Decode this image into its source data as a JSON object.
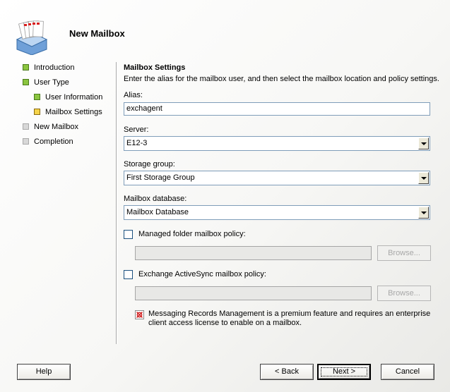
{
  "window": {
    "title": "New Mailbox",
    "header_icon": "mailbox-stack-icon"
  },
  "nav": {
    "items": [
      {
        "label": "Introduction",
        "state": "completed"
      },
      {
        "label": "User Type",
        "state": "completed"
      },
      {
        "label": "User Information",
        "state": "completed"
      },
      {
        "label": "Mailbox Settings",
        "state": "current"
      },
      {
        "label": "New Mailbox",
        "state": "pending"
      },
      {
        "label": "Completion",
        "state": "pending"
      }
    ]
  },
  "main": {
    "section_title": "Mailbox Settings",
    "section_description": "Enter the alias for the mailbox user, and then select the mailbox location and policy settings.",
    "alias": {
      "label": "Alias:",
      "value": "exchagent"
    },
    "server": {
      "label": "Server:",
      "selected": "E12-3"
    },
    "storage_group": {
      "label": "Storage group:",
      "selected": "First Storage Group"
    },
    "mailbox_database": {
      "label": "Mailbox database:",
      "selected": "Mailbox Database"
    },
    "managed_folder_policy": {
      "label": "Managed folder mailbox policy:",
      "checked": false,
      "value": "",
      "browse_label": "Browse..."
    },
    "activesync_policy": {
      "label": "Exchange ActiveSync mailbox policy:",
      "checked": false,
      "value": "",
      "browse_label": "Browse..."
    },
    "note": {
      "icon": "premium-feature-icon",
      "text": "Messaging Records Management is a premium feature and requires an enterprise client access license to enable on a mailbox."
    }
  },
  "footer": {
    "help_label": "Help",
    "back_label": "< Back",
    "next_label": "Next >",
    "cancel_label": "Cancel"
  },
  "colors": {
    "completed": "#8bc53f",
    "current": "#f5d34a",
    "pending": "#d8d8d8",
    "input_border": "#7f9db9"
  }
}
